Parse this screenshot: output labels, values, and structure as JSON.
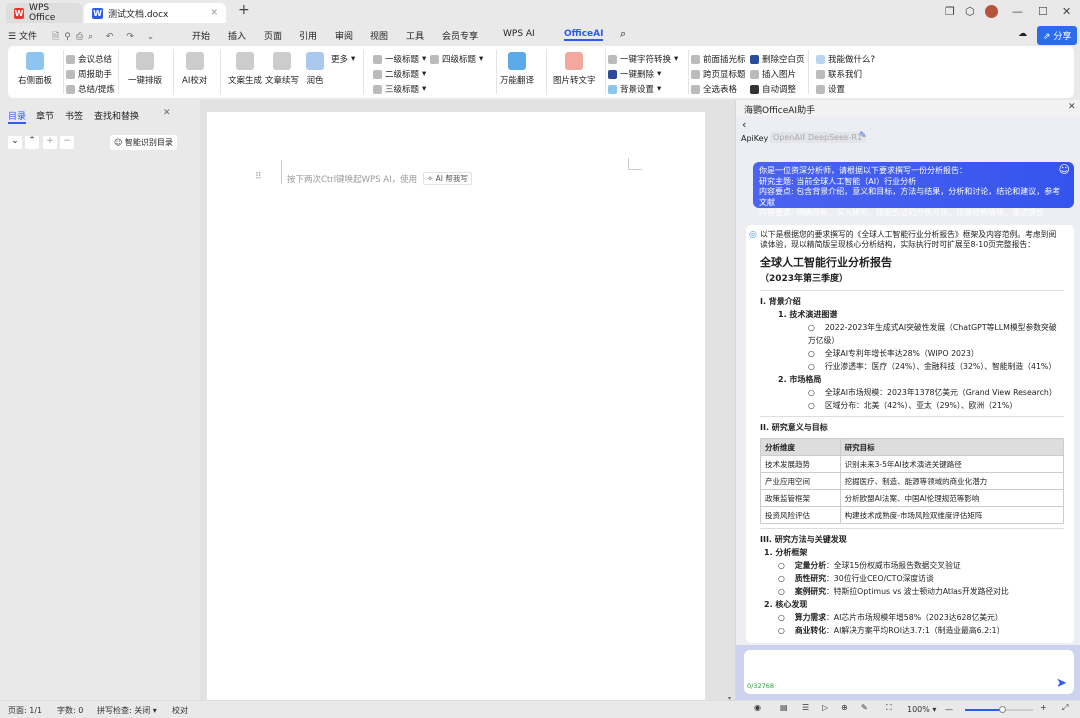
{
  "titlebar": {
    "tabs": [
      {
        "label": "WPS Office",
        "icon": "wps-logo-icon"
      },
      {
        "label": "测试文档.docx",
        "icon": "word-doc-icon"
      }
    ],
    "new_tab": "+"
  },
  "menu": {
    "file": "文件",
    "items": [
      "开始",
      "插入",
      "页面",
      "引用",
      "审阅",
      "视图",
      "工具",
      "会员专享",
      "WPS AI",
      "OfficeAI"
    ],
    "active": "OfficeAI",
    "share": "分享"
  },
  "ribbon": {
    "right_panel": "右侧面板",
    "group1": [
      "会议总结",
      "周报助手",
      "总结/提炼"
    ],
    "layout": "一键排版",
    "proofread": "AI校对",
    "gen": [
      "文案生成",
      "文章续写",
      "润色"
    ],
    "more": "更多",
    "headings": [
      "一级标题",
      "二级标题",
      "三级标题",
      "四级标题"
    ],
    "translate": "万能翻译",
    "ocr": "图片转文字",
    "tools1": [
      "一键字符转换",
      "一键删除",
      "背景设置"
    ],
    "tools2": [
      "前面插光标",
      "跨页显标题",
      "全选表格"
    ],
    "tools3": [
      "删除空白页",
      "插入图片",
      "自动调整"
    ],
    "help": [
      "我能做什么?",
      "联系我们",
      "设置"
    ]
  },
  "leftnav": {
    "tabs": [
      "目录",
      "章节",
      "书签",
      "查找和替换"
    ],
    "smart_toc": "智能识别目录"
  },
  "doc": {
    "hint": "按下两次Ctrl键唤起WPS AI，使用",
    "ai_button": "AI 帮我写"
  },
  "panel": {
    "title": "海鹦OfficeAI助手",
    "api_label": "ApiKey",
    "provider": "OpenAIP",
    "model": "DeepSeek-R1",
    "prompt": [
      "你是一位资深分析师，请根据以下要求撰写一份分析报告：",
      "研究主题: 当前全球人工智能（AI）行业分析",
      "内容要点: 包含背景介绍，意义和目标，方法与结果，分析和讨论，结论和建议，参考文献",
      "内容要求: 明确目标，深入研究，搭配合适的分析方法，段落结构清晰，重点突出"
    ],
    "intro": "以下是根据您的要求撰写的《全球人工智能行业分析报告》框架及内容范例。考虑到阅读体验，现以精简版呈现核心分析结构，实际执行时可扩展至8-10页完整报告：",
    "report_title": "全球人工智能行业分析报告",
    "report_sub": "（2023年第三季度）",
    "s1": "I. 背景介绍",
    "s1_1": "1.  技术演进图谱",
    "s1_1_items": [
      "2022-2023年生成式AI突破性发展（ChatGPT等LLM模型参数突破万亿级）",
      "全球AI专利年增长率达28%（WIPO 2023）",
      "行业渗透率：医疗（24%）、金融科技（32%）、智能制造（41%）"
    ],
    "s1_2": "2.  市场格局",
    "s1_2_items": [
      "全球AI市场规模：2023年1378亿美元（Grand View Research）",
      "区域分布：北美（42%）、亚太（29%）、欧洲（21%）"
    ],
    "s2": "II. 研究意义与目标",
    "table": {
      "headers": [
        "分析维度",
        "研究目标"
      ],
      "rows": [
        [
          "技术发展趋势",
          "识别未来3-5年AI技术演进关键路径"
        ],
        [
          "产业应用空间",
          "挖掘医疗、制造、能源等领域的商业化潜力"
        ],
        [
          "政策监管框架",
          "分析欧盟AI法案、中国AI伦理规范等影响"
        ],
        [
          "投资风险评估",
          "构建技术成熟度-市场风险双维度评估矩阵"
        ]
      ]
    },
    "s3": "III. 研究方法与关键发现",
    "s3_1": "1. 分析框架",
    "s3_1_items": [
      [
        "定量分析",
        "：全球15份权威市场报告数据交叉验证"
      ],
      [
        "质性研究",
        "：30位行业CEO/CTO深度访谈"
      ],
      [
        "案例研究",
        "：特斯拉Optimus vs 波士顿动力Atlas开发路径对比"
      ]
    ],
    "s3_2": "2. 核心发现",
    "s3_2_items": [
      [
        "算力需求",
        "：AI芯片市场规模年增58%（2023达628亿美元）"
      ],
      [
        "商业转化",
        "：AI解决方案平均ROI达3.7:1（制造业最高6.2:1）"
      ]
    ],
    "counter": "0/32768"
  },
  "status": {
    "page": "页面: 1/1",
    "words": "字数: 0",
    "spell": "拼写检查: 关闭",
    "proof": "校对",
    "zoom": "100%",
    "zoom_level": 100
  },
  "colors": {
    "accent": "#2b5de8",
    "bubble": "#3f5bf0",
    "wps_red": "#e8392c"
  }
}
